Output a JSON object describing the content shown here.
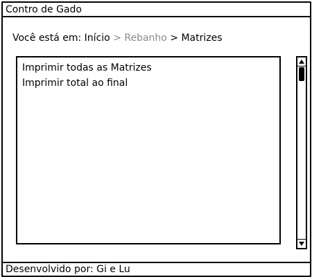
{
  "window": {
    "title": "Contro de Gado"
  },
  "breadcrumb": {
    "prefix": "Você está em: ",
    "items": [
      {
        "label": "Início",
        "style": "dark"
      },
      {
        "label": " > Rebanho",
        "style": "muted"
      },
      {
        "label": " > Matrizes",
        "style": "dark"
      }
    ]
  },
  "list": {
    "items": [
      {
        "label": "Imprimir todas as Matrizes"
      },
      {
        "label": "Imprimir total ao final"
      }
    ]
  },
  "footer": {
    "text": "Desenvolvido por: Gi e Lu"
  },
  "colors": {
    "text": "#000000",
    "muted_text": "#8a8a8a",
    "border": "#000000",
    "background": "#ffffff"
  },
  "icons": {
    "scroll_up": "triangle-up",
    "scroll_down": "triangle-down"
  }
}
